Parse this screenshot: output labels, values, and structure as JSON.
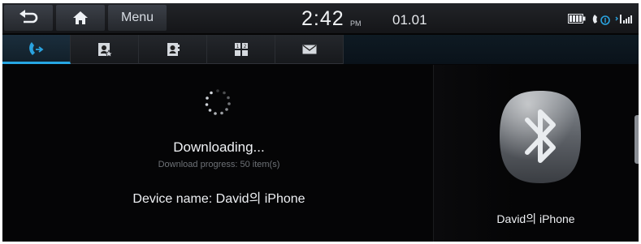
{
  "topbar": {
    "back_icon": "back-arrow-icon",
    "home_icon": "home-icon",
    "menu_label": "Menu",
    "time": "2:42",
    "ampm": "PM",
    "date": "01.01",
    "battery_icon": "battery-icon",
    "bluetooth_phone_icon": "bluetooth-phone-icon",
    "signal_icon": "signal-icon"
  },
  "tabs": [
    {
      "icon": "call-history-icon",
      "active": true
    },
    {
      "icon": "favorites-icon",
      "active": false
    },
    {
      "icon": "contacts-icon",
      "active": false
    },
    {
      "icon": "dial-pad-icon",
      "active": false
    },
    {
      "icon": "messages-icon",
      "active": false
    }
  ],
  "download": {
    "title": "Downloading...",
    "progress_text": "Download progress: 50 item(s)",
    "device_name_text": "Device name: David의 iPhone"
  },
  "bluetooth_panel": {
    "icon": "bluetooth-icon",
    "device_label": "David의 iPhone"
  },
  "colors": {
    "accent": "#27a7e4",
    "background": "#050506"
  }
}
